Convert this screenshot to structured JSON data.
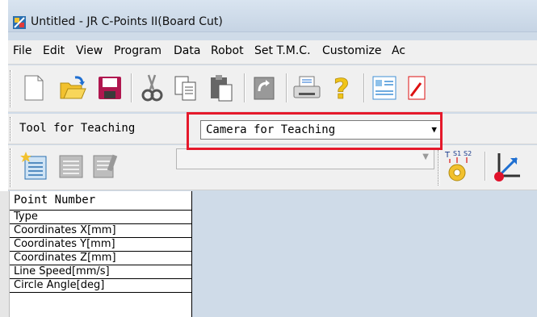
{
  "window": {
    "title": "Untitled - JR C-Points II(Board Cut)"
  },
  "menubar": {
    "items": [
      "File",
      "Edit",
      "View",
      "Program",
      "Data",
      "Robot",
      "Set T.M.C.",
      "Customize",
      "Ac"
    ]
  },
  "toolbar": {
    "icons": [
      "new-file-icon",
      "open-folder-icon",
      "save-icon",
      "cut-icon",
      "copy-icon",
      "paste-icon",
      "refresh-icon",
      "print-icon",
      "help-icon",
      "list-view-icon",
      "edit-icon"
    ]
  },
  "teaching_bar": {
    "label": "Tool for Teaching",
    "selected": "Camera for Teaching"
  },
  "toolbar3": {
    "icons": [
      "new-point-icon",
      "insert-point-icon",
      "edit-point-icon",
      "tool-s1s2-icon",
      "teach-arrow-icon"
    ],
    "tool_icon_letters": [
      "T",
      "S1",
      "S2"
    ]
  },
  "grid": {
    "header": "Point Number",
    "rows": [
      "Type",
      "Coordinates X[mm]",
      "Coordinates Y[mm]",
      "Coordinates Z[mm]",
      "Line Speed[mm/s]",
      "Circle Angle[deg]"
    ]
  },
  "colors": {
    "highlight": "#e5192b",
    "frame": "#cfdbe8"
  }
}
